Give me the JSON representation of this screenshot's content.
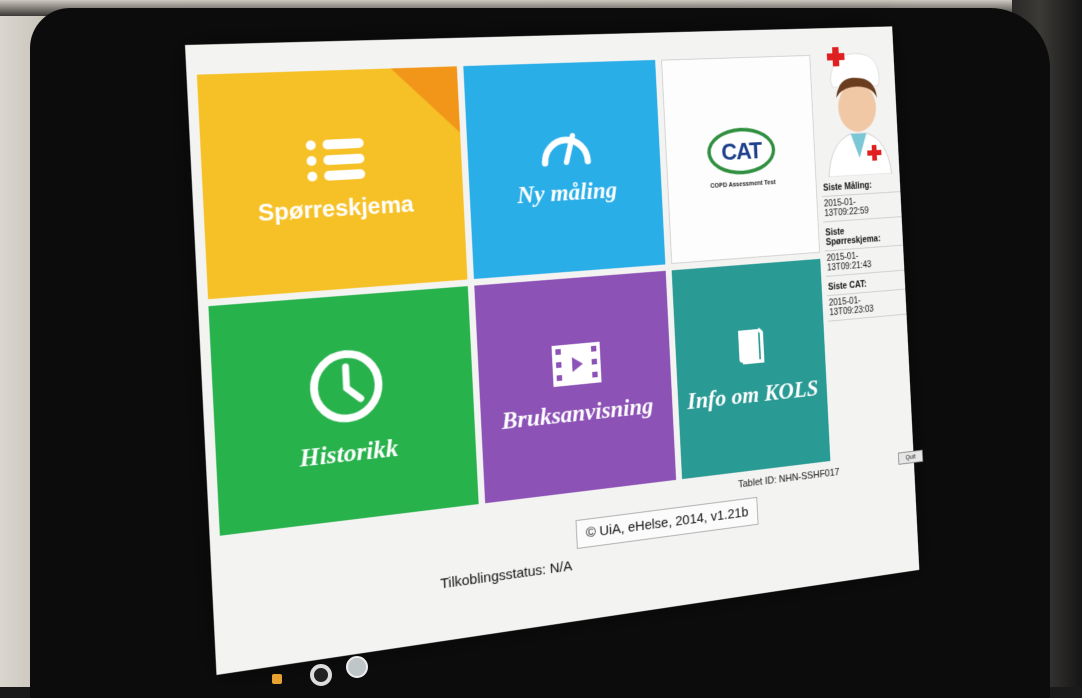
{
  "tiles": {
    "questionnaire": "Spørreskjema",
    "new_measurement": "Ny måling",
    "cat": {
      "logo_text": "CAT",
      "subtitle": "COPD Assessment Test"
    },
    "history": "Historikk",
    "user_guide": "Bruksanvisning",
    "info_kols": "Info om KOLS"
  },
  "status": {
    "last_measurement_label": "Siste Måling:",
    "last_measurement_value": "2015-01-13T09:22:59",
    "last_questionnaire_label": "Siste Spørreskjema:",
    "last_questionnaire_value": "2015-01-13T09:21:43",
    "last_cat_label": "Siste CAT:",
    "last_cat_value": "2015-01-13T09:23:03"
  },
  "footer": {
    "tablet_id": "Tablet ID: NHN-SSHF017",
    "quit_label": "Quit",
    "copyright": "© UiA, eHelse, 2014, v1.21b",
    "connection_status": "Tilkoblingsstatus: N/A"
  },
  "icons": {
    "questionnaire": "list-icon",
    "new_measurement": "gauge-icon",
    "history": "clock-icon",
    "user_guide": "video-icon",
    "info_kols": "book-icon",
    "nurse": "nurse-avatar-icon"
  },
  "colors": {
    "questionnaire": "#f6c127",
    "new_measurement": "#2aaee8",
    "history": "#27b24c",
    "user_guide": "#8c52b6",
    "info_kols": "#2a9a94",
    "accent_corner": "#f2961a"
  }
}
